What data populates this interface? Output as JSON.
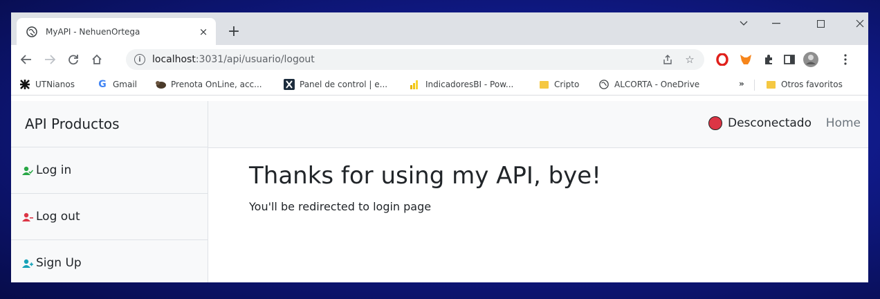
{
  "browser": {
    "tab_title": "MyAPI - NehuenOrtega",
    "tab_close": "×",
    "new_tab": "+",
    "url_host": "localhost",
    "url_path": ":3031/api/usuario/logout"
  },
  "bookmarks": [
    {
      "label": "UTNianos",
      "icon": "utn-icon"
    },
    {
      "label": "Gmail",
      "icon": "google-icon"
    },
    {
      "label": "Prenota OnLine, acc...",
      "icon": "prenota-icon"
    },
    {
      "label": "Panel de control | e...",
      "icon": "panel-icon"
    },
    {
      "label": "IndicadoresBI - Pow...",
      "icon": "powerbi-icon"
    },
    {
      "label": "Cripto",
      "icon": "folder-icon"
    },
    {
      "label": "ALCORTA - OneDrive",
      "icon": "globe-icon"
    }
  ],
  "bookmarks_more": "»",
  "bookmarks_other": "Otros favoritos",
  "app": {
    "brand": "API Productos",
    "sidebar": [
      {
        "label": "Log in",
        "color": "#28a745"
      },
      {
        "label": "Log out",
        "color": "#dc3545"
      },
      {
        "label": "Sign Up",
        "color": "#17a2b8"
      }
    ],
    "status": "Desconectado",
    "status_color": "#dc3545",
    "home": "Home",
    "heading": "Thanks for using my API, bye!",
    "message": "You'll be redirected to login page"
  }
}
